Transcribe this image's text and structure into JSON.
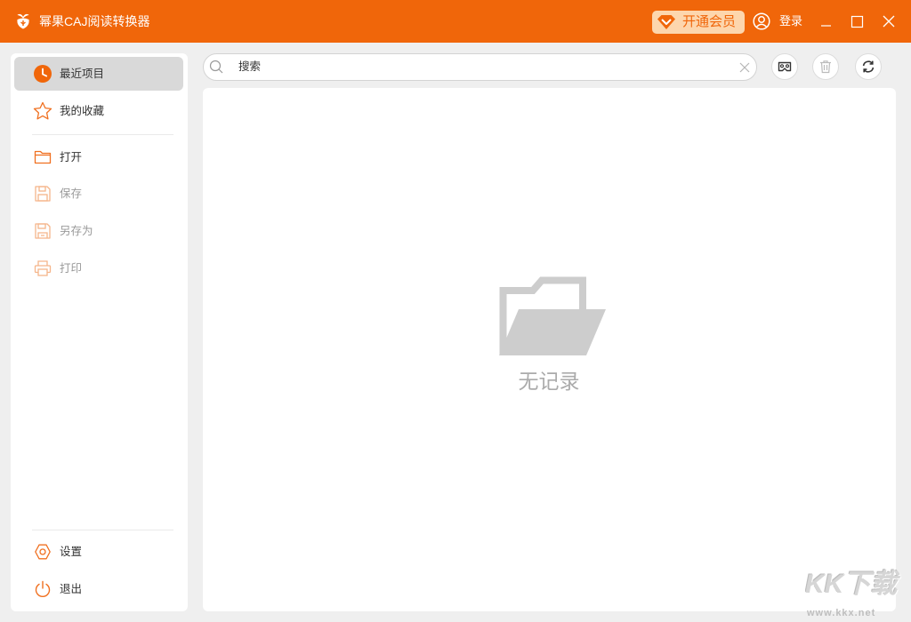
{
  "window": {
    "title": "幂果CAJ阅读转换器",
    "logo_icon": "app-logo"
  },
  "titlebar": {
    "vip_label": "开通会员",
    "vip_icon": "diamond-icon",
    "login_label": "登录",
    "login_icon": "user-icon",
    "controls": [
      "minimize-icon",
      "maximize-icon",
      "close-icon"
    ]
  },
  "sidebar": {
    "top_items": [
      {
        "label": "最近项目",
        "icon": "clock-icon",
        "selected": true
      },
      {
        "label": "我的收藏",
        "icon": "star-icon",
        "selected": false
      }
    ],
    "file_items": [
      {
        "label": "打开",
        "icon": "folder-icon"
      },
      {
        "label": "保存",
        "icon": "save-icon"
      },
      {
        "label": "另存为",
        "icon": "save-as-icon"
      },
      {
        "label": "打印",
        "icon": "printer-icon"
      }
    ],
    "bottom_items": [
      {
        "label": "设置",
        "icon": "settings-icon"
      },
      {
        "label": "退出",
        "icon": "power-icon"
      }
    ]
  },
  "search": {
    "placeholder": "搜索",
    "icon": "search-icon",
    "clear_icon": "clear-icon"
  },
  "toolbar": {
    "buttons": [
      {
        "icon": "glasses-icon"
      },
      {
        "icon": "trash-icon"
      },
      {
        "icon": "refresh-icon"
      }
    ]
  },
  "empty_state": {
    "icon": "empty-folder-icon",
    "text": "无记录"
  },
  "watermark": {
    "title": "KK下载",
    "url": "www.kkx.net"
  },
  "colors": {
    "accent": "#F0660A",
    "vip_background": "#FDD6AD",
    "selected_item": "#D9D9D9",
    "icon_active": "#F07020",
    "icon_disabled": "#F5B58A",
    "empty_gray": "#CDCDCD",
    "background": "#EFEFEF"
  }
}
